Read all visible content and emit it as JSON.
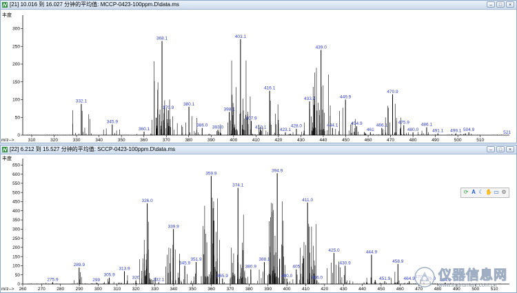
{
  "top_window": {
    "title": "[21] 10.016 到 16.027 分钟的平均值: MCCP-0423-100ppm.D\\data.ms",
    "y_axis_label": "丰度",
    "x_axis_prefix": "m/z-->",
    "buttons": {
      "minimize": "–",
      "restore": "□",
      "close": "×"
    }
  },
  "bottom_window": {
    "title": "[22] 6.212 到 15.527 分钟的平均值: SCCP-0423-100ppm.D\\data.ms",
    "y_axis_label": "丰度",
    "x_axis_prefix": "m/z-->",
    "buttons": {
      "minimize": "–",
      "restore": "□",
      "close": "×"
    },
    "toolbar_icons": [
      "refresh-icon",
      "text-icon",
      "moon-icon",
      "hand-icon",
      "rectangle-icon",
      "settings-icon"
    ]
  },
  "watermark": {
    "cn": "仪器信息网",
    "url": "www.instrument.com.cn"
  },
  "colors": {
    "peak": "#000000",
    "peak_label": "#2b39c9",
    "titlebar": "#cfdced"
  },
  "chart_data": [
    {
      "type": "bar",
      "name": "MCCP spectrum",
      "xlim": [
        306,
        523
      ],
      "ylim": [
        0,
        330
      ],
      "x_ticks": [
        310,
        320,
        330,
        340,
        350,
        360,
        370,
        380,
        390,
        400,
        410,
        420,
        430,
        440,
        450,
        460,
        470,
        480,
        490,
        500,
        510
      ],
      "y_ticks": [
        0,
        50,
        100,
        150,
        200,
        250,
        300
      ],
      "end_label": "521",
      "labeled_peaks": [
        {
          "mz": 332.1,
          "label": "332.1",
          "y": 88
        },
        {
          "mz": 345.9,
          "label": "345.9",
          "y": 30
        },
        {
          "mz": 360.1,
          "label": "360.1",
          "y": 10
        },
        {
          "mz": 368.1,
          "label": "368.1",
          "y": 265
        },
        {
          "mz": 370.9,
          "label": "370.9",
          "y": 70
        },
        {
          "mz": 380.1,
          "label": "380.1",
          "y": 80
        },
        {
          "mz": 386.0,
          "label": "386.0",
          "y": 20
        },
        {
          "mz": 393.0,
          "label": "393.0",
          "y": 15
        },
        {
          "mz": 398.1,
          "label": "398.1",
          "y": 65
        },
        {
          "mz": 403.1,
          "label": "403.1",
          "y": 270
        },
        {
          "mz": 407.9,
          "label": "407.9",
          "y": 40
        },
        {
          "mz": 412.1,
          "label": "412.1",
          "y": 15
        },
        {
          "mz": 416.1,
          "label": "416.1",
          "y": 125
        },
        {
          "mz": 423.1,
          "label": "423.1",
          "y": 8
        },
        {
          "mz": 428.0,
          "label": "428.0",
          "y": 18
        },
        {
          "mz": 433.9,
          "label": "433.9",
          "y": 95
        },
        {
          "mz": 439.0,
          "label": "439.0",
          "y": 240
        },
        {
          "mz": 444.1,
          "label": "444.1",
          "y": 20
        },
        {
          "mz": 449.9,
          "label": "449.9",
          "y": 100
        },
        {
          "mz": 454.9,
          "label": "454.9",
          "y": 25
        },
        {
          "mz": 461,
          "label": "461",
          "y": 8
        },
        {
          "mz": 466.1,
          "label": "466.1",
          "y": 20
        },
        {
          "mz": 470.9,
          "label": "470.9",
          "y": 115
        },
        {
          "mz": 475.9,
          "label": "475.9",
          "y": 28
        },
        {
          "mz": 480.0,
          "label": "480.0",
          "y": 8
        },
        {
          "mz": 486.1,
          "label": "486.1",
          "y": 22
        },
        {
          "mz": 491.1,
          "label": "491.1",
          "y": 5
        },
        {
          "mz": 499.1,
          "label": "499.1",
          "y": 5
        },
        {
          "mz": 504.9,
          "label": "504.9",
          "y": 8
        }
      ]
    },
    {
      "type": "bar",
      "name": "SCCP spectrum",
      "xlim": [
        260,
        518
      ],
      "ylim": [
        0,
        670
      ],
      "x_ticks": [
        260,
        270,
        280,
        290,
        300,
        310,
        320,
        330,
        340,
        350,
        360,
        370,
        380,
        390,
        400,
        410,
        420,
        430,
        440,
        450,
        460,
        470,
        480,
        490,
        500,
        510
      ],
      "y_ticks": [
        0,
        50,
        100,
        150,
        200,
        250,
        300,
        350,
        400,
        450,
        500,
        550,
        600,
        650
      ],
      "labeled_peaks": [
        {
          "mz": 275.9,
          "label": "275.9",
          "y": 10
        },
        {
          "mz": 289.9,
          "label": "289.9",
          "y": 90
        },
        {
          "mz": 299,
          "label": "299",
          "y": 8
        },
        {
          "mz": 305.9,
          "label": "305.9",
          "y": 35
        },
        {
          "mz": 313.9,
          "label": "313.9",
          "y": 70
        },
        {
          "mz": 320,
          "label": "320",
          "y": 20
        },
        {
          "mz": 326.0,
          "label": "326.0",
          "y": 440
        },
        {
          "mz": 332.1,
          "label": "332.1",
          "y": 10
        },
        {
          "mz": 339.9,
          "label": "339.9",
          "y": 300
        },
        {
          "mz": 345.9,
          "label": "345.9",
          "y": 100
        },
        {
          "mz": 351.9,
          "label": "351.9",
          "y": 120
        },
        {
          "mz": 359.9,
          "label": "359.9",
          "y": 590
        },
        {
          "mz": 365.9,
          "label": "365.9",
          "y": 30
        },
        {
          "mz": 374.1,
          "label": "374.1",
          "y": 525
        },
        {
          "mz": 380.9,
          "label": "380.9",
          "y": 80
        },
        {
          "mz": 388.1,
          "label": "388.1",
          "y": 120
        },
        {
          "mz": 394.9,
          "label": "394.9",
          "y": 605
        },
        {
          "mz": 400.0,
          "label": "400.0",
          "y": 30
        },
        {
          "mz": 405,
          "label": "405",
          "y": 80
        },
        {
          "mz": 411.0,
          "label": "411.0",
          "y": 445
        },
        {
          "mz": 416.0,
          "label": "416.0",
          "y": 20
        },
        {
          "mz": 425.0,
          "label": "425.0",
          "y": 170
        },
        {
          "mz": 430.9,
          "label": "430.9",
          "y": 100
        },
        {
          "mz": 444.9,
          "label": "444.9",
          "y": 160
        },
        {
          "mz": 451.9,
          "label": "451.9",
          "y": 15
        },
        {
          "mz": 458.9,
          "label": "458.9",
          "y": 110
        },
        {
          "mz": 464.9,
          "label": "464.9",
          "y": 15
        },
        {
          "mz": 470.9,
          "label": "470.9",
          "y": 25
        },
        {
          "mz": 476.0,
          "label": "476.0",
          "y": 15
        },
        {
          "mz": 484.0,
          "label": "484.0",
          "y": 8
        }
      ]
    }
  ]
}
